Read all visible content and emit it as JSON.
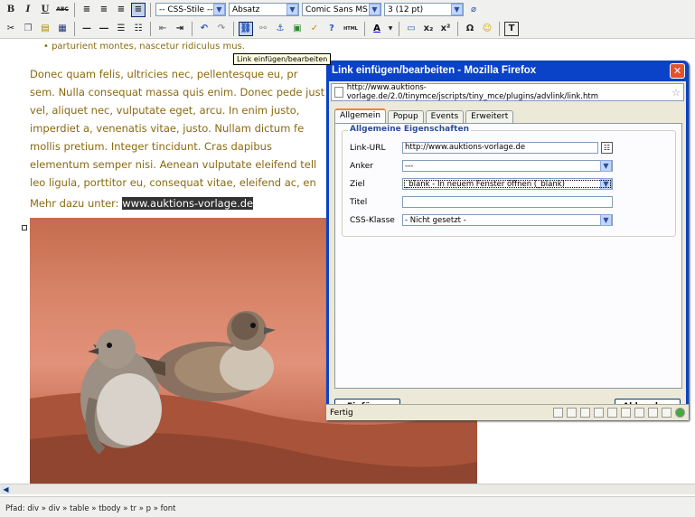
{
  "toolbar1": {
    "bold": "B",
    "italic": "I",
    "underline": "U",
    "strike": "ABC",
    "style_select": "-- CSS-Stile --",
    "format_select": "Absatz",
    "font_select": "Comic Sans MS",
    "size_select": "3 (12 pt)"
  },
  "toolbar2": {
    "sub": "x₂",
    "sup": "x²",
    "omega": "Ω",
    "html": "HTML",
    "color_a": "A"
  },
  "tooltip": "Link einfügen/bearbeiten",
  "editor": {
    "line0": "• parturient montes, nascetur ridiculus mus.",
    "lines": [
      "Donec quam felis, ultricies nec, pellentesque eu, pr",
      "sem. Nulla consequat massa quis enim. Donec pede just",
      "vel, aliquet nec, vulputate eget, arcu. In enim justo,",
      "imperdiet a, venenatis vitae, justo. Nullam dictum fe",
      "mollis pretium. Integer tincidunt. Cras dapibus",
      "elementum semper nisi. Aenean vulputate eleifend tell",
      "leo ligula, porttitor eu, consequat vitae, eleifend ac, en"
    ],
    "more_prefix": "Mehr dazu unter: ",
    "more_link": "www.auktions-vorlage.de"
  },
  "status_path": "Pfad: div » div » table » tbody » tr » p » font",
  "dialog": {
    "title": "Link einfügen/bearbeiten - Mozilla Firefox",
    "close": "✕",
    "url": "http://www.auktions-vorlage.de/2.0/tinymce/jscripts/tiny_mce/plugins/advlink/link.htm",
    "tabs": [
      "Allgemein",
      "Popup",
      "Events",
      "Erweitert"
    ],
    "legend": "Allgemeine Eigenschaften",
    "fields": {
      "link_url_label": "Link-URL",
      "link_url_value": "http://www.auktions-vorlage.de",
      "anchor_label": "Anker",
      "anchor_value": "---",
      "target_label": "Ziel",
      "target_value": "_blank - In neuem Fenster öffnen (_blank)",
      "title_label": "Titel",
      "title_value": "",
      "css_label": "CSS-Klasse",
      "css_value": "- Nicht gesetzt -"
    },
    "insert_button": "Einfügen",
    "cancel_button": "Abbrechen",
    "status": "Fertig"
  }
}
